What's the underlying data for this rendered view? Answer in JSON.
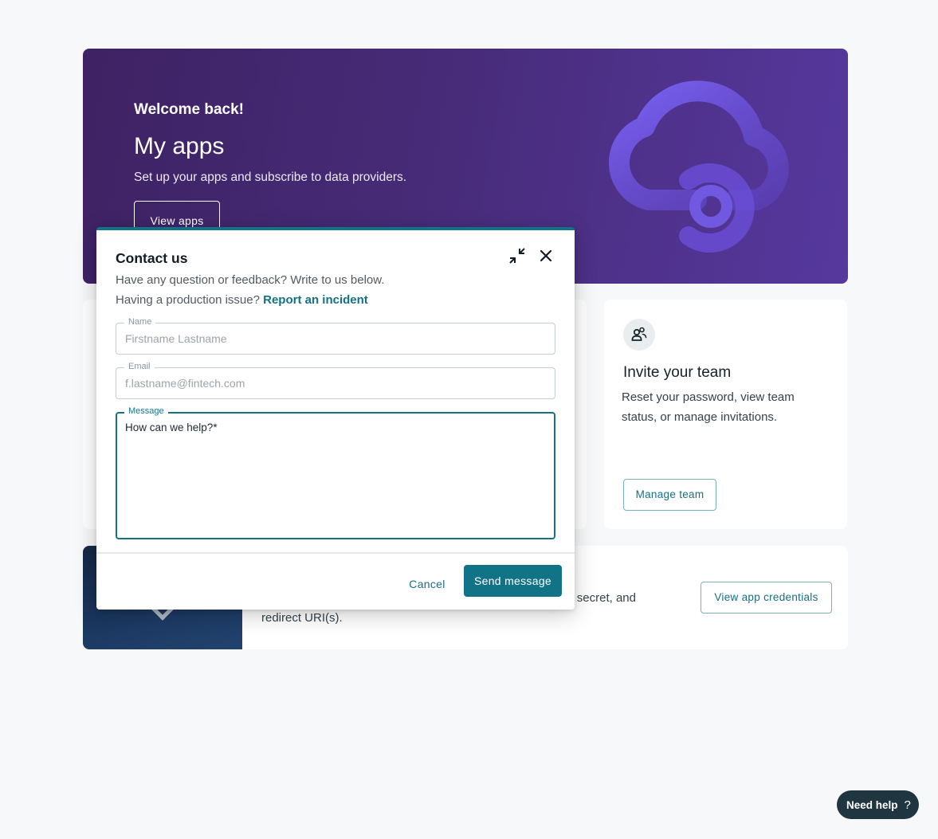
{
  "hero": {
    "welcome": "Welcome back!",
    "title": "My apps",
    "subtitle": "Set up your apps and subscribe to data providers.",
    "button_label": "View apps",
    "illustration_icon": "cloud-link-icon"
  },
  "team_card": {
    "icon": "team-icon",
    "title": "Invite your team",
    "description": "Reset your password, view team status, or manage invitations.",
    "button_label": "Manage team"
  },
  "credentials_card": {
    "description_visible_1": "secret, and",
    "description_visible_2": "redirect URI(s).",
    "button_label": "View app credentials"
  },
  "contact_modal": {
    "title": "Contact us",
    "intro": "Have any question or feedback? Write to us below.",
    "incident_prompt": "Having a production issue?",
    "incident_link": "Report an incident",
    "fields": {
      "name": {
        "label": "Name",
        "placeholder": "Firstname Lastname",
        "value": ""
      },
      "email": {
        "label": "Email",
        "placeholder": "f.lastname@fintech.com",
        "value": ""
      },
      "message": {
        "label": "Message",
        "placeholder": "How can we help?*",
        "value": ""
      }
    },
    "cancel_label": "Cancel",
    "send_label": "Send message",
    "accent_color": "#117386"
  },
  "help_button": {
    "label": "Need help",
    "icon": "?"
  }
}
